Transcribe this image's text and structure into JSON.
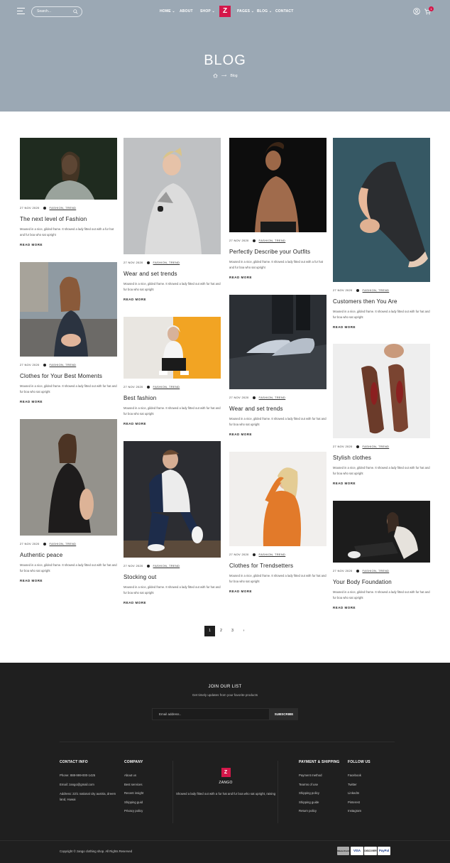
{
  "header": {
    "search_placeholder": "Search...",
    "nav_left": [
      {
        "label": "HOME",
        "caret": "⌄"
      },
      {
        "label": "ABOUT",
        "caret": ""
      },
      {
        "label": "SHOP",
        "caret": "⌄"
      }
    ],
    "logo_letter": "Z",
    "nav_right": [
      {
        "label": "PAGES",
        "caret": "⌄"
      },
      {
        "label": "BLOG",
        "caret": "⌄"
      },
      {
        "label": "CONTACT",
        "caret": ""
      }
    ],
    "cart_count": "1",
    "background": "#9ba8b4",
    "accent": "#d4174a"
  },
  "hero": {
    "title": "BLOG",
    "breadcrumb_current": "Blog"
  },
  "posts": [
    {
      "date": "27 NOV 2020",
      "tags": "FASHION, TREND",
      "title": "The next level of Fashion",
      "excerpt": "Moused in a nice, gilded frame. It showed a lady fitted out with a fur hat and fur boa who sat upright",
      "read_more": "READ MORE"
    },
    {
      "date": "27 NOV 2020",
      "tags": "FASHION, TREND",
      "title": "Wear and set trends",
      "excerpt": "Moused in a nice, gilded frame. It showed a lady fitted out with fur hat and fur boa who sat upright",
      "read_more": "READ MORE"
    },
    {
      "date": "27 NOV 2020",
      "tags": "FASHION, TREND",
      "title": "Perfectly Describe your Outfits",
      "excerpt": "Moused in a nice, gilded frame. It showed a lady fitted out with a fur hat and fur boa who sat upright",
      "read_more": "READ MORE"
    },
    {
      "date": "27 NOV 2020",
      "tags": "FASHION, TREND",
      "title": "Customers then You Are",
      "excerpt": "Moused in a nice, gilded frame. It showed a lady fitted out with fur hat and fur boa who sat upright",
      "read_more": "READ MORE"
    },
    {
      "date": "27 NOV 2020",
      "tags": "FASHION, TREND",
      "title": "Clothes for Your Best Moments",
      "excerpt": "Moused in a nice, gilded frame. It showed a lady fitted out with fur hat and fur boa who sat upright",
      "read_more": "READ MORE"
    },
    {
      "date": "27 NOV 2020",
      "tags": "FASHION, TREND",
      "title": "Best fashion",
      "excerpt": "Moused in a nice, gilded frame. It showed a lady fitted out with fur hat and fur boa who sat upright",
      "read_more": "READ MORE"
    },
    {
      "date": "27 NOV 2020",
      "tags": "FASHION, TREND",
      "title": "Wear and set trends",
      "excerpt": "Moused in a nice, gilded frame. It showed a lady fitted out with fur hat and fur boa who sat upright",
      "read_more": "READ MORE"
    },
    {
      "date": "27 NOV 2020",
      "tags": "FASHION, TREND",
      "title": "Stylish clothes",
      "excerpt": "Moused in a nice, gilded frame. It showed a lady fitted out with fur hat and fur boa who sat upright",
      "read_more": "READ MORE"
    },
    {
      "date": "27 NOV 2020",
      "tags": "FASHION, TREND",
      "title": "Authentic peace",
      "excerpt": "Moused in a nice, gilded frame. It showed a lady fitted out with fur hat and fur boa who sat upright",
      "read_more": "READ MORE"
    },
    {
      "date": "27 NOV 2020",
      "tags": "FASHION, TREND",
      "title": "Stocking out",
      "excerpt": "Moused in a nice, gilded frame. It showed a lady fitted out with fur hat and fur boa who sat upright",
      "read_more": "READ MORE"
    },
    {
      "date": "27 NOV 2020",
      "tags": "FASHION, TREND",
      "title": "Clothes for Trendsetters",
      "excerpt": "Moused in a nice, gilded frame. It showed a lady fitted out with fur hat and fur boa who sat upright",
      "read_more": "READ MORE"
    },
    {
      "date": "27 NOV 2020",
      "tags": "FASHION, TREND",
      "title": "Your Body Foundation",
      "excerpt": "Moused in a nice, gilded frame. It showed a lady fitted out with fur hat and fur boa who sat upright",
      "read_more": "READ MORE"
    }
  ],
  "pagination": {
    "pages": [
      "1",
      "2",
      "3"
    ],
    "current": "1",
    "next": "›"
  },
  "footer": {
    "newsletter_title": "JOIN OUR LIST",
    "newsletter_sub": "Get timely updates from your favorite products",
    "email_placeholder": "Email address..",
    "subscribe_label": "SUBSCRIBE",
    "contact": {
      "title": "CONTACT INFO",
      "phone": "Phone: 888-999-000-1425",
      "email": "Email: zango@gmail.com",
      "address": "Address: 22/1 national city austria, dreem land, Huwai"
    },
    "company": {
      "title": "COMPANY",
      "links": [
        "About us",
        "Best services",
        "Recent insight",
        "Shipping guid",
        "Privacy policy"
      ]
    },
    "brand": {
      "letter": "Z",
      "name": "ZANGO",
      "desc": "Showed a lady fitted out with a fur hat and fur boa who sat upright, raising"
    },
    "payment": {
      "title": "PAYMENT & SHIPPING",
      "links": [
        "Payment method",
        "Tearms of use",
        "Shipping policy",
        "Shipping guide",
        "Return policy"
      ]
    },
    "follow": {
      "title": "FOLLOW US",
      "links": [
        "Facebook",
        "Twitter",
        "LinkedIn",
        "Pinterest",
        "Instagram"
      ]
    },
    "copyright": "Copyright © zango clothing shop. All Rights Reserved",
    "payment_badges": [
      "MasterCard",
      "VISA",
      "DISCOVER",
      "PayPal"
    ]
  }
}
